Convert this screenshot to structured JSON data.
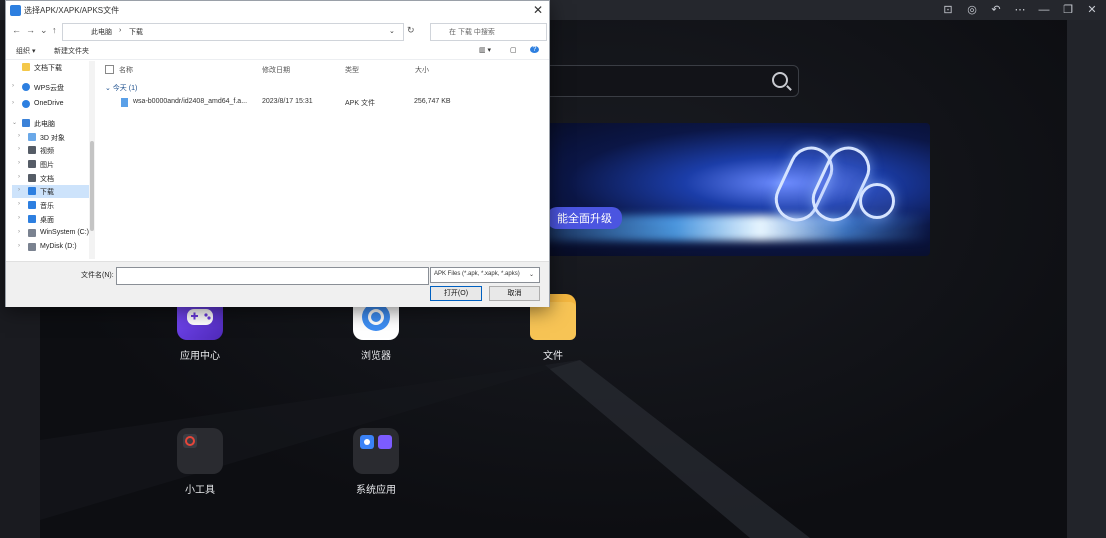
{
  "app": {
    "title_controls": [
      "⊡",
      "◎",
      "↶",
      "⋯",
      "—",
      "❐",
      "✕"
    ]
  },
  "emulator": {
    "banner_badge": "能全面升级",
    "apps": [
      {
        "label": "应用中心",
        "icon": "gamepad-icon",
        "color": "#6c3ce0"
      },
      {
        "label": "浏览器",
        "icon": "browser-icon",
        "color": "#ffffff"
      },
      {
        "label": "文件",
        "icon": "folder-icon",
        "color": "#f4b740"
      },
      {
        "label": "小工具",
        "icon": "tools-icon",
        "color": "#2a2b30"
      },
      {
        "label": "系统应用",
        "icon": "system-apps-icon",
        "color": "#2a2b30"
      }
    ]
  },
  "dialog": {
    "title": "选择APK/XAPK/APKS文件",
    "close": "✕",
    "nav_back": "←",
    "nav_forward": "→",
    "nav_recent": "⌄",
    "nav_up": "↑",
    "address": [
      "此电脑",
      "下载"
    ],
    "refresh": "↻",
    "search_placeholder": "在 下载 中搜索",
    "organize": "组织 ▾",
    "new_folder": "新建文件夹",
    "view_icons": [
      "▥ ▾",
      "▢",
      "?"
    ],
    "nav_items": [
      {
        "label": "文档下载",
        "color": "#f4c84a"
      },
      {
        "label": "WPS云盘",
        "color": "#2d7fe0"
      },
      {
        "label": "OneDrive",
        "color": "#2d7fe0"
      },
      {
        "label": "此电脑",
        "color": "#3b82d8"
      },
      {
        "label": "3D 对象",
        "color": "#6aa8e8"
      },
      {
        "label": "视频",
        "color": "#555c66"
      },
      {
        "label": "图片",
        "color": "#555c66"
      },
      {
        "label": "文档",
        "color": "#555c66"
      },
      {
        "label": "下载",
        "color": "#2d7fe0"
      },
      {
        "label": "音乐",
        "color": "#2d7fe0"
      },
      {
        "label": "桌面",
        "color": "#2d7fe0"
      },
      {
        "label": "WinSystem (C:)",
        "color": "#7a8290"
      },
      {
        "label": "MyDisk (D:)",
        "color": "#7a8290"
      }
    ],
    "columns": [
      "名称",
      "修改日期",
      "类型",
      "大小"
    ],
    "group": "⌄ 今天 (1)",
    "file": {
      "name": "wsa-b0000andr/id2408_amd64_f.a...",
      "date": "2023/8/17 15:31",
      "type": "APK 文件",
      "size": "256,747 KB"
    },
    "filename_label": "文件名(N):",
    "filename_value": "",
    "filetype": "APK Files (*.apk, *.xapk, *.apks)",
    "open_button": "打开(O)",
    "cancel_button": "取消"
  }
}
